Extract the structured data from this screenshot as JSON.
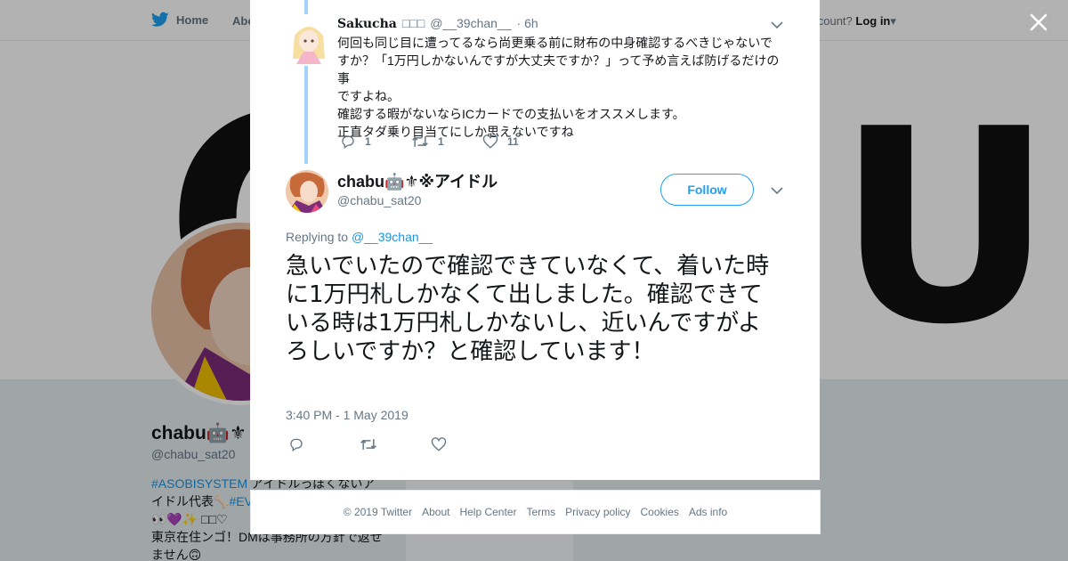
{
  "background": {
    "nav": {
      "home_label": "Home",
      "about_label": "Abo",
      "account_prompt": "account?",
      "login_label": "Log in"
    },
    "profile": {
      "name": "chabu🤖⚜",
      "handle": "@chabu_sat20",
      "bio_hashtag_1": "#ASOBISYSTEM",
      "bio_line_1": " アイドルっぽくないア",
      "bio_line_2": "イドル代表🦴",
      "bio_hashtag_2": "#EV",
      "bio_line_3": "👀💜✨ □□♡",
      "bio_line_4": "東京在住ンゴ！DMは事務所の方針で返せ",
      "bio_line_5": "ません🙃"
    },
    "ads_label": "Ads info"
  },
  "modal": {
    "parent_tweet": {
      "name": "Sakucha",
      "name_suffix": "□□□",
      "handle": "@__39chan__",
      "time": "· 6h",
      "text_lines": [
        "何回も同じ目に遭ってるなら尚更乗る前に財布の中身確認するべきじゃないで",
        "すか？「1万円しかないんですが大丈夫ですか？」って予め言えば防げるだけの事",
        "ですよね。",
        "確認する暇がないならICカードでの支払いをオススメします。",
        "正直タダ乗り目当てにしか思えないですね"
      ],
      "reply_count": "1",
      "retweet_count": "1",
      "like_count": "11"
    },
    "main_tweet": {
      "name": "chabu🤖⚜※アイドル",
      "handle": "@chabu_sat20",
      "follow_label": "Follow",
      "replying_prefix": "Replying to",
      "replying_handle": "@__39chan__",
      "text": "急いでいたので確認できていなくて、着いた時に1万円札しかなくて出しました。確認できている時は1万円札しかないし、近いんですがよろしいですか？と確認しています！",
      "timestamp": "3:40 PM - 1 May 2019"
    }
  },
  "footer": {
    "copyright": "© 2019 Twitter",
    "about": "About",
    "help": "Help Center",
    "terms": "Terms",
    "privacy": "Privacy policy",
    "cookies": "Cookies",
    "ads": "Ads info"
  },
  "colors": {
    "twitter_blue": "#1da1f2",
    "link_blue": "#1b95e0",
    "thread_line": "#a3d3f5",
    "secondary_text": "#657786"
  }
}
